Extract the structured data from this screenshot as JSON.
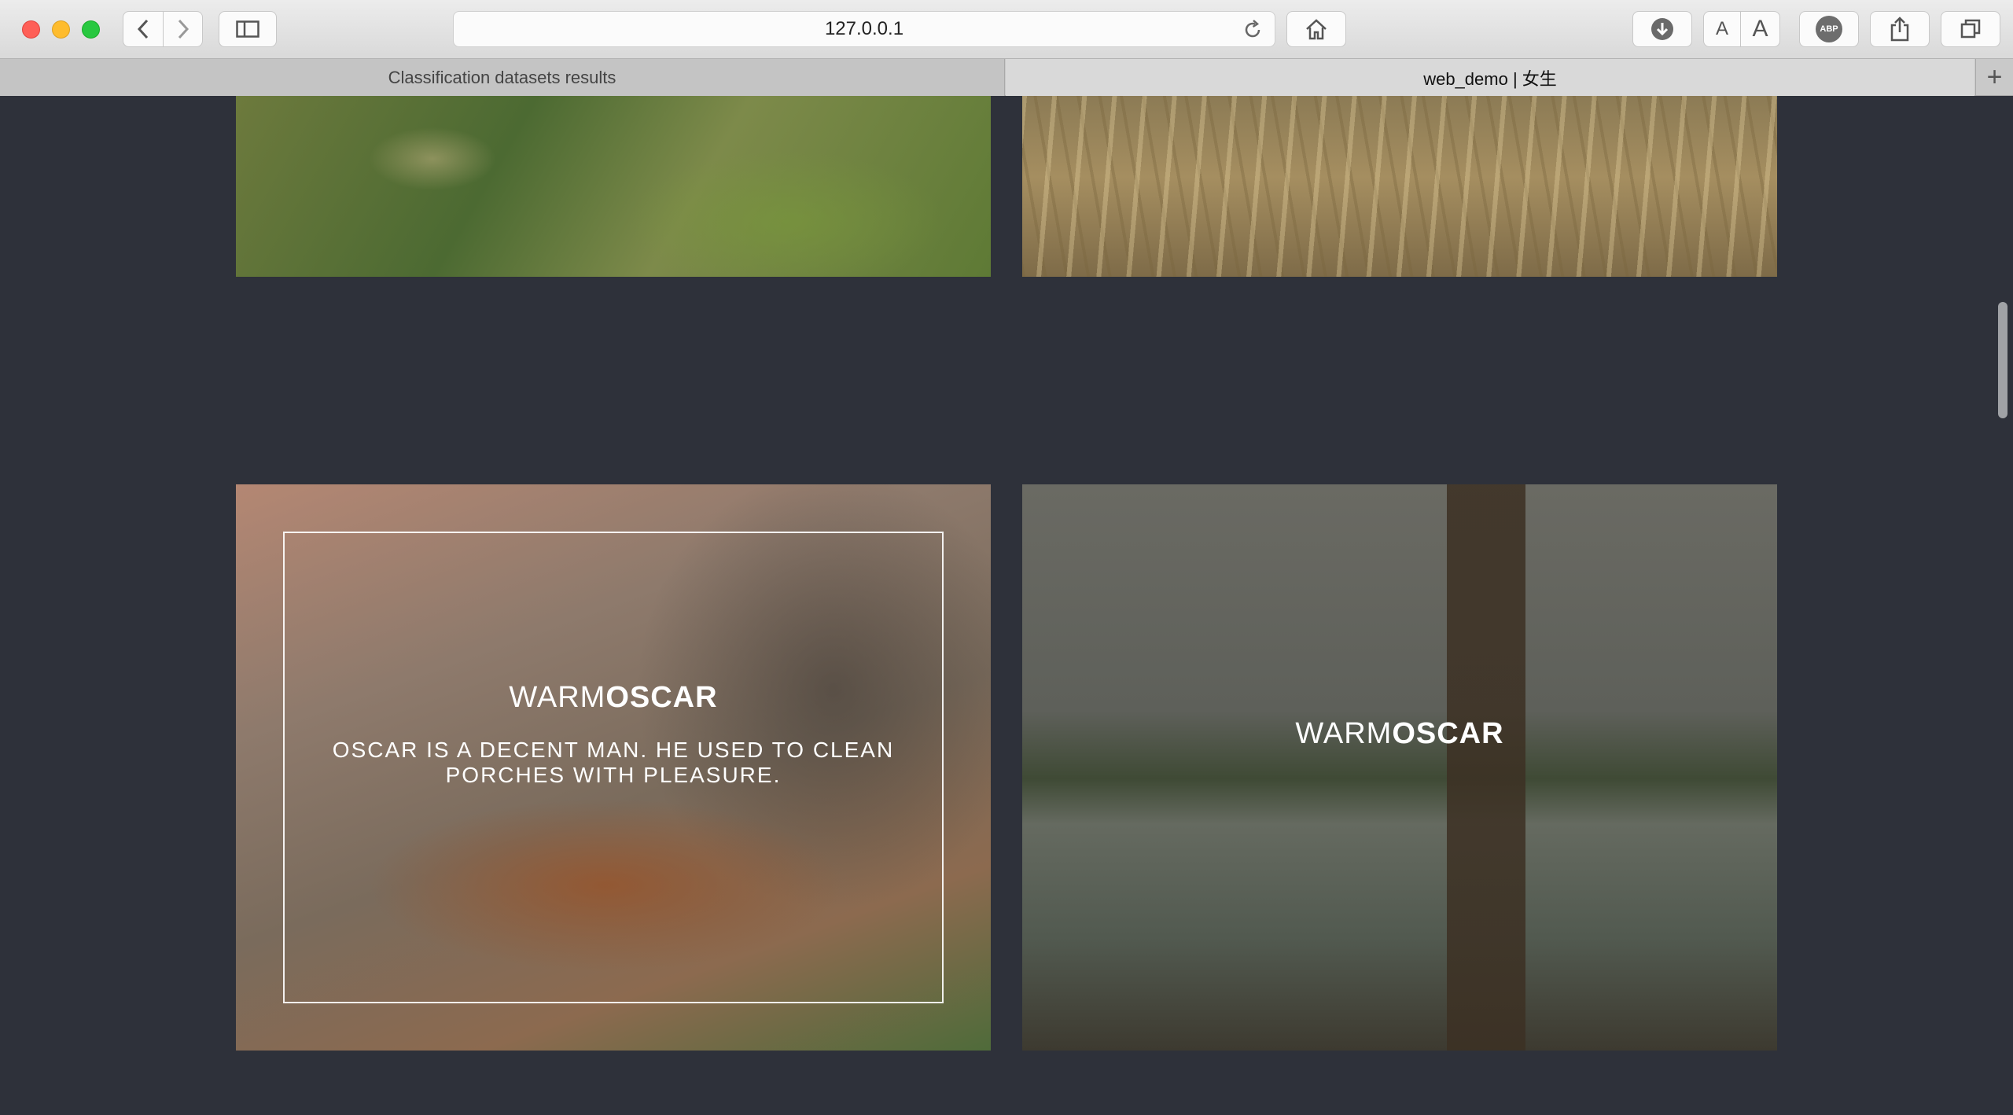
{
  "browser": {
    "url": "127.0.0.1",
    "tabs": [
      {
        "label": "Classification datasets results",
        "active": false
      },
      {
        "label": "web_demo | 女生",
        "active": true
      }
    ],
    "new_tab_label": "+",
    "reader_small": "A",
    "reader_big": "A",
    "adblock_label": "ABP"
  },
  "cards": [
    {
      "title_light": "WARM",
      "title_bold": "OSCAR",
      "description": "OSCAR IS A DECENT MAN. HE USED TO CLEAN PORCHES WITH PLEASURE."
    },
    {
      "title_light": "WARM",
      "title_bold": "OSCAR"
    }
  ]
}
